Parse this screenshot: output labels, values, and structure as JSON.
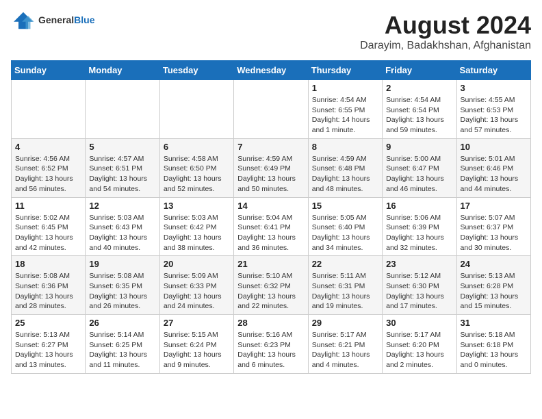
{
  "logo": {
    "general": "General",
    "blue": "Blue"
  },
  "header": {
    "title": "August 2024",
    "subtitle": "Darayim, Badakhshan, Afghanistan"
  },
  "days_of_week": [
    "Sunday",
    "Monday",
    "Tuesday",
    "Wednesday",
    "Thursday",
    "Friday",
    "Saturday"
  ],
  "weeks": [
    [
      {
        "day": "",
        "info": ""
      },
      {
        "day": "",
        "info": ""
      },
      {
        "day": "",
        "info": ""
      },
      {
        "day": "",
        "info": ""
      },
      {
        "day": "1",
        "info": "Sunrise: 4:54 AM\nSunset: 6:55 PM\nDaylight: 14 hours\nand 1 minute."
      },
      {
        "day": "2",
        "info": "Sunrise: 4:54 AM\nSunset: 6:54 PM\nDaylight: 13 hours\nand 59 minutes."
      },
      {
        "day": "3",
        "info": "Sunrise: 4:55 AM\nSunset: 6:53 PM\nDaylight: 13 hours\nand 57 minutes."
      }
    ],
    [
      {
        "day": "4",
        "info": "Sunrise: 4:56 AM\nSunset: 6:52 PM\nDaylight: 13 hours\nand 56 minutes."
      },
      {
        "day": "5",
        "info": "Sunrise: 4:57 AM\nSunset: 6:51 PM\nDaylight: 13 hours\nand 54 minutes."
      },
      {
        "day": "6",
        "info": "Sunrise: 4:58 AM\nSunset: 6:50 PM\nDaylight: 13 hours\nand 52 minutes."
      },
      {
        "day": "7",
        "info": "Sunrise: 4:59 AM\nSunset: 6:49 PM\nDaylight: 13 hours\nand 50 minutes."
      },
      {
        "day": "8",
        "info": "Sunrise: 4:59 AM\nSunset: 6:48 PM\nDaylight: 13 hours\nand 48 minutes."
      },
      {
        "day": "9",
        "info": "Sunrise: 5:00 AM\nSunset: 6:47 PM\nDaylight: 13 hours\nand 46 minutes."
      },
      {
        "day": "10",
        "info": "Sunrise: 5:01 AM\nSunset: 6:46 PM\nDaylight: 13 hours\nand 44 minutes."
      }
    ],
    [
      {
        "day": "11",
        "info": "Sunrise: 5:02 AM\nSunset: 6:45 PM\nDaylight: 13 hours\nand 42 minutes."
      },
      {
        "day": "12",
        "info": "Sunrise: 5:03 AM\nSunset: 6:43 PM\nDaylight: 13 hours\nand 40 minutes."
      },
      {
        "day": "13",
        "info": "Sunrise: 5:03 AM\nSunset: 6:42 PM\nDaylight: 13 hours\nand 38 minutes."
      },
      {
        "day": "14",
        "info": "Sunrise: 5:04 AM\nSunset: 6:41 PM\nDaylight: 13 hours\nand 36 minutes."
      },
      {
        "day": "15",
        "info": "Sunrise: 5:05 AM\nSunset: 6:40 PM\nDaylight: 13 hours\nand 34 minutes."
      },
      {
        "day": "16",
        "info": "Sunrise: 5:06 AM\nSunset: 6:39 PM\nDaylight: 13 hours\nand 32 minutes."
      },
      {
        "day": "17",
        "info": "Sunrise: 5:07 AM\nSunset: 6:37 PM\nDaylight: 13 hours\nand 30 minutes."
      }
    ],
    [
      {
        "day": "18",
        "info": "Sunrise: 5:08 AM\nSunset: 6:36 PM\nDaylight: 13 hours\nand 28 minutes."
      },
      {
        "day": "19",
        "info": "Sunrise: 5:08 AM\nSunset: 6:35 PM\nDaylight: 13 hours\nand 26 minutes."
      },
      {
        "day": "20",
        "info": "Sunrise: 5:09 AM\nSunset: 6:33 PM\nDaylight: 13 hours\nand 24 minutes."
      },
      {
        "day": "21",
        "info": "Sunrise: 5:10 AM\nSunset: 6:32 PM\nDaylight: 13 hours\nand 22 minutes."
      },
      {
        "day": "22",
        "info": "Sunrise: 5:11 AM\nSunset: 6:31 PM\nDaylight: 13 hours\nand 19 minutes."
      },
      {
        "day": "23",
        "info": "Sunrise: 5:12 AM\nSunset: 6:30 PM\nDaylight: 13 hours\nand 17 minutes."
      },
      {
        "day": "24",
        "info": "Sunrise: 5:13 AM\nSunset: 6:28 PM\nDaylight: 13 hours\nand 15 minutes."
      }
    ],
    [
      {
        "day": "25",
        "info": "Sunrise: 5:13 AM\nSunset: 6:27 PM\nDaylight: 13 hours\nand 13 minutes."
      },
      {
        "day": "26",
        "info": "Sunrise: 5:14 AM\nSunset: 6:25 PM\nDaylight: 13 hours\nand 11 minutes."
      },
      {
        "day": "27",
        "info": "Sunrise: 5:15 AM\nSunset: 6:24 PM\nDaylight: 13 hours\nand 9 minutes."
      },
      {
        "day": "28",
        "info": "Sunrise: 5:16 AM\nSunset: 6:23 PM\nDaylight: 13 hours\nand 6 minutes."
      },
      {
        "day": "29",
        "info": "Sunrise: 5:17 AM\nSunset: 6:21 PM\nDaylight: 13 hours\nand 4 minutes."
      },
      {
        "day": "30",
        "info": "Sunrise: 5:17 AM\nSunset: 6:20 PM\nDaylight: 13 hours\nand 2 minutes."
      },
      {
        "day": "31",
        "info": "Sunrise: 5:18 AM\nSunset: 6:18 PM\nDaylight: 13 hours\nand 0 minutes."
      }
    ]
  ]
}
